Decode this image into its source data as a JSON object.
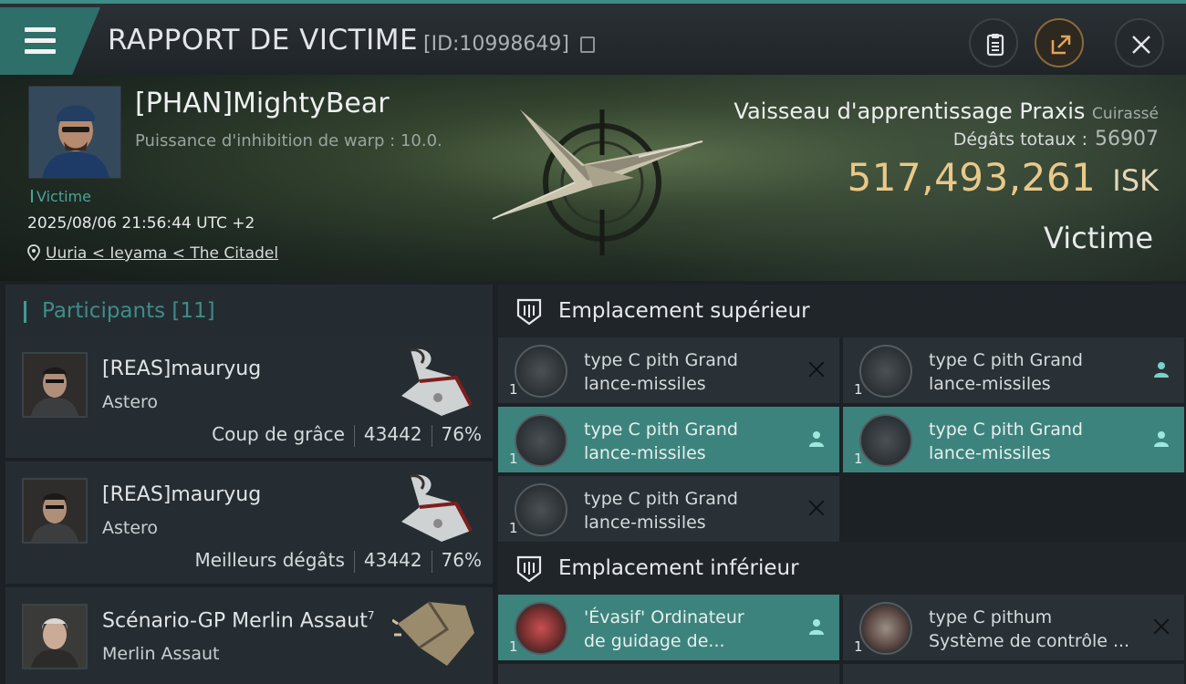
{
  "header": {
    "title": "RAPPORT DE VICTIME",
    "report_id": "[ID:10998649]"
  },
  "victim": {
    "name": "[PHAN]MightyBear",
    "subtitle": "Puissance d'inhibition de warp : 10.0.",
    "tag": "Victime",
    "datetime": "2025/08/06 21:56:44 UTC +2",
    "location": "Uuria < Ieyama < The Citadel",
    "ship_name": "Vaisseau d'apprentissage Praxis",
    "ship_class": "Cuirassé",
    "damage_label": "Dégâts totaux :",
    "damage_value": "56907",
    "isk_value": "517,493,261",
    "isk_unit": "ISK",
    "role": "Victime"
  },
  "participants": {
    "title": "Participants",
    "count": "[11]",
    "rows": [
      {
        "name": "[REAS]mauryug",
        "ship": "Astero",
        "label": "Coup de grâce",
        "damage": "43442",
        "percent": "76%"
      },
      {
        "name": "[REAS]mauryug",
        "ship": "Astero",
        "label": "Meilleurs dégâts",
        "damage": "43442",
        "percent": "76%"
      },
      {
        "name": "Scénario-GP Merlin Assaut",
        "superscript": "7",
        "ship": "Merlin Assaut"
      }
    ]
  },
  "slots": {
    "high_title": "Emplacement supérieur",
    "low_title": "Emplacement inférieur",
    "high_items": [
      {
        "qty": "1",
        "line1": "type C pith Grand",
        "line2": "lance-missiles",
        "action": "destroyed"
      },
      {
        "qty": "1",
        "line1": "type C pith Grand",
        "line2": "lance-missiles",
        "action": "dropped"
      },
      {
        "qty": "1",
        "line1": "type C pith Grand",
        "line2": "lance-missiles",
        "action": "dropped"
      },
      {
        "qty": "1",
        "line1": "type C pith Grand",
        "line2": "lance-missiles",
        "action": "dropped"
      },
      {
        "qty": "1",
        "line1": "type C pith Grand",
        "line2": "lance-missiles",
        "action": "destroyed"
      }
    ],
    "low_items": [
      {
        "qty": "1",
        "line1": "'Évasif'  Ordinateur",
        "line2": "de guidage de...",
        "action": "dropped"
      },
      {
        "qty": "1",
        "line1": "type C pithum",
        "line2": "Système de contrôle ...",
        "action": "destroyed"
      }
    ]
  },
  "colors": {
    "accent": "#3e8c86",
    "isk": "#e8c989",
    "highlight": "#3d837d"
  }
}
